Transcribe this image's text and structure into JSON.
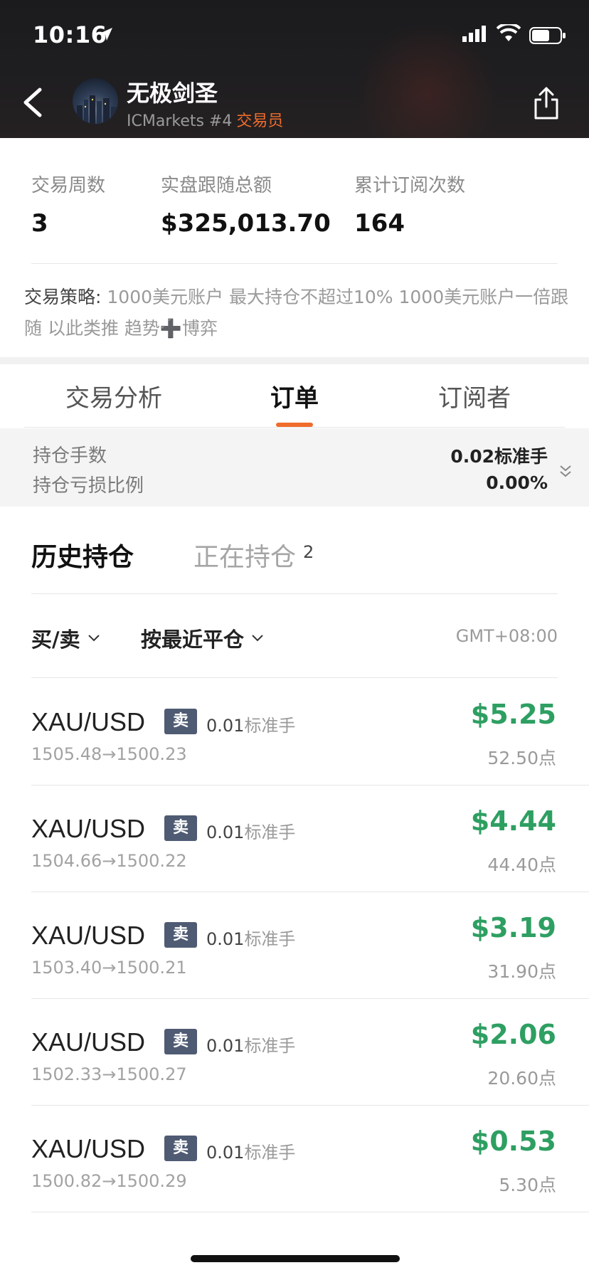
{
  "status_bar": {
    "time": "10:16"
  },
  "header": {
    "trader_name": "无极剑圣",
    "broker": "ICMarkets #4",
    "role": "交易员"
  },
  "stats": [
    {
      "label": "交易周数",
      "value": "3"
    },
    {
      "label": "实盘跟随总额",
      "value": "$325,013.70"
    },
    {
      "label": "累计订阅次数",
      "value": "164"
    }
  ],
  "strategy": {
    "title": "交易策略:",
    "text": "1000美元账户  最大持仓不超过10%  1000美元账户一倍跟随  以此类推  趋势➕博弈"
  },
  "tabs": [
    {
      "label": "交易分析",
      "active": false
    },
    {
      "label": "订单",
      "active": true
    },
    {
      "label": "订阅者",
      "active": false
    }
  ],
  "summary": {
    "lots_label": "持仓手数",
    "lots_value": "0.02标准手",
    "loss_label": "持仓亏损比例",
    "loss_value": "0.00%"
  },
  "subtabs": {
    "history": "历史持仓",
    "open": "正在持仓",
    "open_count": "2"
  },
  "filters": {
    "side": "买/卖",
    "sort": "按最近平仓",
    "timezone": "GMT+08:00"
  },
  "orders": [
    {
      "symbol": "XAU/USD",
      "side": "卖",
      "lot": "0.01",
      "lot_unit": "标准手",
      "prices": "1505.48→1500.23",
      "profit": "$5.25",
      "points": "52.50点"
    },
    {
      "symbol": "XAU/USD",
      "side": "卖",
      "lot": "0.01",
      "lot_unit": "标准手",
      "prices": "1504.66→1500.22",
      "profit": "$4.44",
      "points": "44.40点"
    },
    {
      "symbol": "XAU/USD",
      "side": "卖",
      "lot": "0.01",
      "lot_unit": "标准手",
      "prices": "1503.40→1500.21",
      "profit": "$3.19",
      "points": "31.90点"
    },
    {
      "symbol": "XAU/USD",
      "side": "卖",
      "lot": "0.01",
      "lot_unit": "标准手",
      "prices": "1502.33→1500.27",
      "profit": "$2.06",
      "points": "20.60点"
    },
    {
      "symbol": "XAU/USD",
      "side": "卖",
      "lot": "0.01",
      "lot_unit": "标准手",
      "prices": "1500.82→1500.29",
      "profit": "$0.53",
      "points": "5.30点"
    }
  ],
  "colors": {
    "accent": "#f06c2c",
    "profit_green": "#2e9f62",
    "sell_badge": "#4f5b73",
    "header_bg": "#1d1c1e"
  }
}
